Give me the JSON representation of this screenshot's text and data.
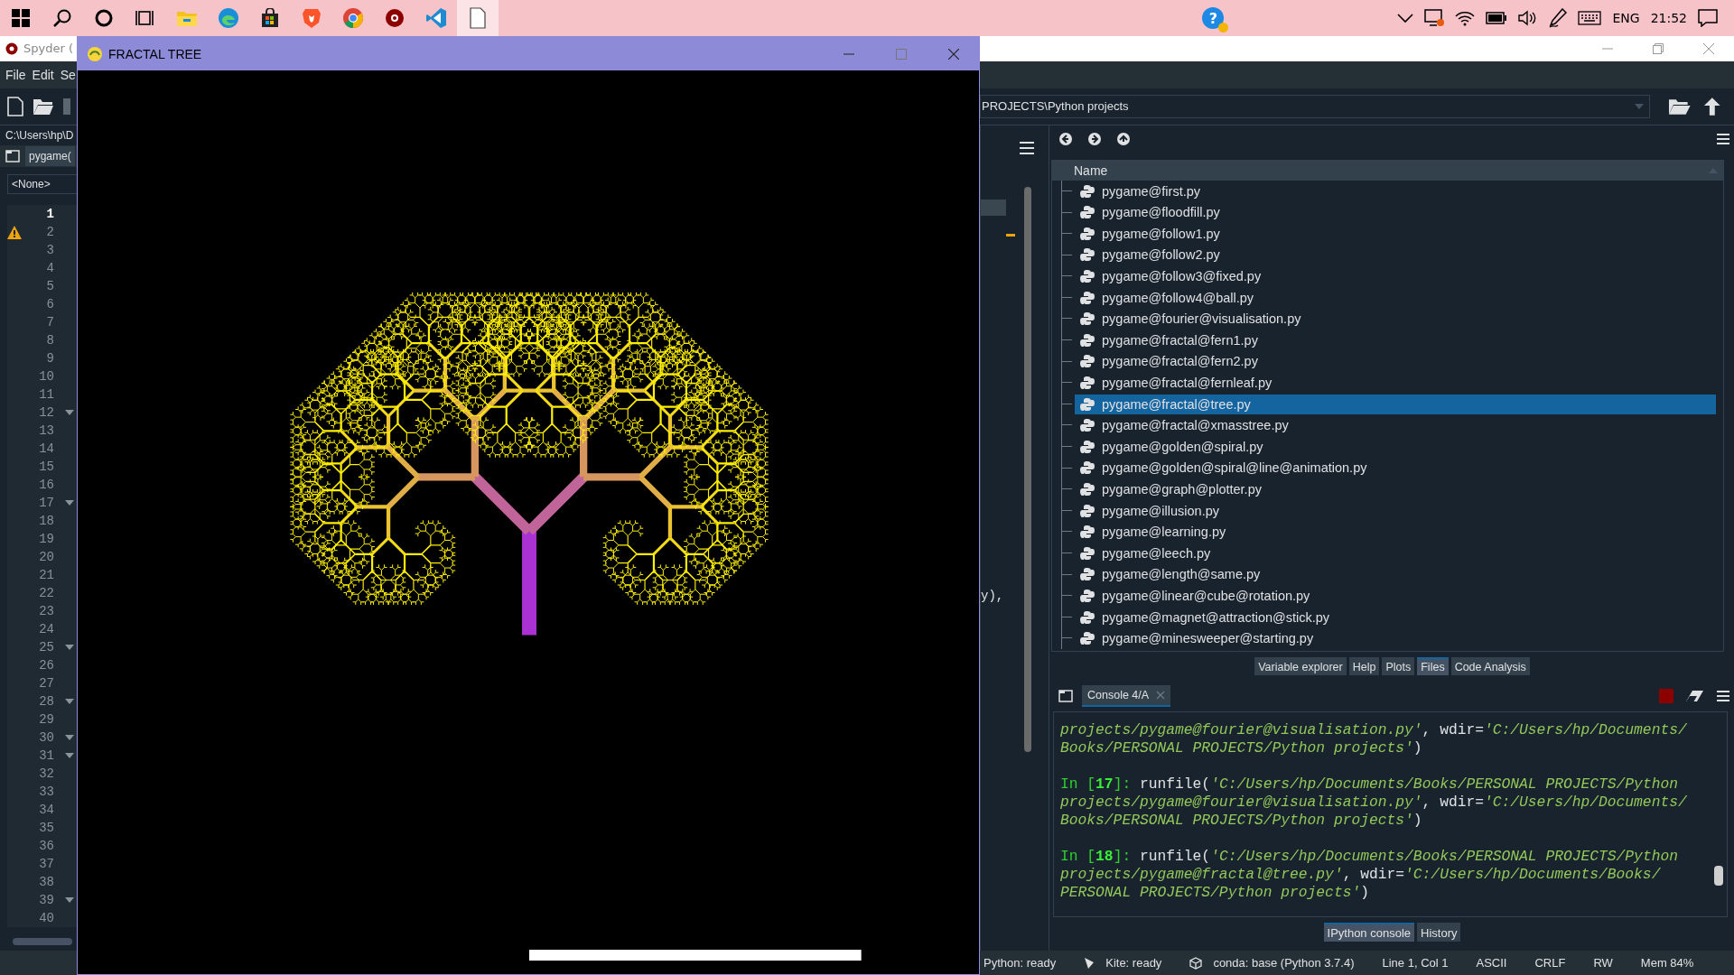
{
  "taskbar": {
    "apps": [
      {
        "kind": "windows",
        "selected": false
      },
      {
        "kind": "search",
        "selected": false
      },
      {
        "kind": "cortana",
        "selected": false
      },
      {
        "kind": "taskview",
        "selected": false
      },
      {
        "kind": "explorer",
        "selected": false
      },
      {
        "kind": "edge",
        "selected": false
      },
      {
        "kind": "store",
        "selected": false
      },
      {
        "kind": "brave",
        "selected": false
      },
      {
        "kind": "chrome",
        "selected": false
      },
      {
        "kind": "spyder",
        "selected": false
      },
      {
        "kind": "vscode",
        "selected": false
      },
      {
        "kind": "notepad",
        "selected": true
      }
    ],
    "help_badge": "?",
    "language": "ENG",
    "time": "21:52"
  },
  "spyder": {
    "title": "Spyder (",
    "menu": [
      "File",
      "Edit",
      "Se"
    ],
    "editor_path": "C:\\Users\\hp\\D",
    "editor_tab": "pygame(",
    "outline_combo": "<None>",
    "lines": [
      {
        "number": "1",
        "current": true,
        "warning": false,
        "fold": false
      },
      {
        "number": "2",
        "current": false,
        "warning": true,
        "fold": false
      },
      {
        "number": "3",
        "current": false,
        "warning": false,
        "fold": false
      },
      {
        "number": "4",
        "current": false,
        "warning": false,
        "fold": false
      },
      {
        "number": "5",
        "current": false,
        "warning": false,
        "fold": false
      },
      {
        "number": "6",
        "current": false,
        "warning": false,
        "fold": false
      },
      {
        "number": "7",
        "current": false,
        "warning": false,
        "fold": false
      },
      {
        "number": "8",
        "current": false,
        "warning": false,
        "fold": false
      },
      {
        "number": "9",
        "current": false,
        "warning": false,
        "fold": false
      },
      {
        "number": "10",
        "current": false,
        "warning": false,
        "fold": false
      },
      {
        "number": "11",
        "current": false,
        "warning": false,
        "fold": false
      },
      {
        "number": "12",
        "current": false,
        "warning": false,
        "fold": true
      },
      {
        "number": "13",
        "current": false,
        "warning": false,
        "fold": false
      },
      {
        "number": "14",
        "current": false,
        "warning": false,
        "fold": false
      },
      {
        "number": "15",
        "current": false,
        "warning": false,
        "fold": false
      },
      {
        "number": "16",
        "current": false,
        "warning": false,
        "fold": false
      },
      {
        "number": "17",
        "current": false,
        "warning": false,
        "fold": true
      },
      {
        "number": "18",
        "current": false,
        "warning": false,
        "fold": false
      },
      {
        "number": "19",
        "current": false,
        "warning": false,
        "fold": false
      },
      {
        "number": "20",
        "current": false,
        "warning": false,
        "fold": false
      },
      {
        "number": "21",
        "current": false,
        "warning": false,
        "fold": false
      },
      {
        "number": "22",
        "current": false,
        "warning": false,
        "fold": false
      },
      {
        "number": "23",
        "current": false,
        "warning": false,
        "fold": false
      },
      {
        "number": "24",
        "current": false,
        "warning": false,
        "fold": false
      },
      {
        "number": "25",
        "current": false,
        "warning": false,
        "fold": true
      },
      {
        "number": "26",
        "current": false,
        "warning": false,
        "fold": false
      },
      {
        "number": "27",
        "current": false,
        "warning": false,
        "fold": false
      },
      {
        "number": "28",
        "current": false,
        "warning": false,
        "fold": true
      },
      {
        "number": "29",
        "current": false,
        "warning": false,
        "fold": false
      },
      {
        "number": "30",
        "current": false,
        "warning": false,
        "fold": true
      },
      {
        "number": "31",
        "current": false,
        "warning": false,
        "fold": true
      },
      {
        "number": "32",
        "current": false,
        "warning": false,
        "fold": false
      },
      {
        "number": "33",
        "current": false,
        "warning": false,
        "fold": false
      },
      {
        "number": "34",
        "current": false,
        "warning": false,
        "fold": false
      },
      {
        "number": "35",
        "current": false,
        "warning": false,
        "fold": false
      },
      {
        "number": "36",
        "current": false,
        "warning": false,
        "fold": false
      },
      {
        "number": "37",
        "current": false,
        "warning": false,
        "fold": false
      },
      {
        "number": "38",
        "current": false,
        "warning": false,
        "fold": false
      },
      {
        "number": "39",
        "current": false,
        "warning": false,
        "fold": true
      },
      {
        "number": "40",
        "current": false,
        "warning": false,
        "fold": false
      }
    ],
    "code_fragment": "y),",
    "files": {
      "path": "PROJECTS\\Python projects",
      "column": "Name",
      "items": [
        {
          "name": "pygame@first.py",
          "selected": false
        },
        {
          "name": "pygame@floodfill.py",
          "selected": false
        },
        {
          "name": "pygame@follow1.py",
          "selected": false
        },
        {
          "name": "pygame@follow2.py",
          "selected": false
        },
        {
          "name": "pygame@follow3@fixed.py",
          "selected": false
        },
        {
          "name": "pygame@follow4@ball.py",
          "selected": false
        },
        {
          "name": "pygame@fourier@visualisation.py",
          "selected": false
        },
        {
          "name": "pygame@fractal@fern1.py",
          "selected": false
        },
        {
          "name": "pygame@fractal@fern2.py",
          "selected": false
        },
        {
          "name": "pygame@fractal@fernleaf.py",
          "selected": false
        },
        {
          "name": "pygame@fractal@tree.py",
          "selected": true
        },
        {
          "name": "pygame@fractal@xmasstree.py",
          "selected": false
        },
        {
          "name": "pygame@golden@spiral.py",
          "selected": false
        },
        {
          "name": "pygame@golden@spiral@line@animation.py",
          "selected": false
        },
        {
          "name": "pygame@graph@plotter.py",
          "selected": false
        },
        {
          "name": "pygame@illusion.py",
          "selected": false
        },
        {
          "name": "pygame@learning.py",
          "selected": false
        },
        {
          "name": "pygame@leech.py",
          "selected": false
        },
        {
          "name": "pygame@length@same.py",
          "selected": false
        },
        {
          "name": "pygame@linear@cube@rotation.py",
          "selected": false
        },
        {
          "name": "pygame@magnet@attraction@stick.py",
          "selected": false
        },
        {
          "name": "pygame@minesweeper@starting.py",
          "selected": false
        }
      ]
    },
    "pane_tabs": [
      {
        "label": "Variable explorer",
        "selected": false
      },
      {
        "label": "Help",
        "selected": false
      },
      {
        "label": "Plots",
        "selected": false
      },
      {
        "label": "Files",
        "selected": true
      },
      {
        "label": "Code Analysis",
        "selected": false
      }
    ],
    "console": {
      "tab": "Console 4/A",
      "blocks": [
        {
          "lines": [
            [
              {
                "kind": "string",
                "text": "projects/pygame@fourier@visualisation.py'"
              },
              {
                "kind": "plain",
                "text": ", wdir="
              },
              {
                "kind": "string",
                "text": "'C:/Users/hp/Documents/"
              }
            ],
            [
              {
                "kind": "string",
                "text": "Books/PERSONAL PROJECTS/Python projects'"
              },
              {
                "kind": "plain",
                "text": ")"
              }
            ]
          ]
        },
        {
          "prompt": {
            "before": "In [",
            "number": "17",
            "after": "]:"
          },
          "lines": [
            [
              {
                "kind": "plain",
                "text": "runfile("
              },
              {
                "kind": "string",
                "text": "'C:/Users/hp/Documents/Books/PERSONAL PROJECTS/Python"
              }
            ],
            [
              {
                "kind": "string",
                "text": "projects/pygame@fourier@visualisation.py'"
              },
              {
                "kind": "plain",
                "text": ", wdir="
              },
              {
                "kind": "string",
                "text": "'C:/Users/hp/Documents/"
              }
            ],
            [
              {
                "kind": "string",
                "text": "Books/PERSONAL PROJECTS/Python projects'"
              },
              {
                "kind": "plain",
                "text": ")"
              }
            ]
          ]
        },
        {
          "prompt": {
            "before": "In [",
            "number": "18",
            "after": "]:"
          },
          "lines": [
            [
              {
                "kind": "plain",
                "text": "runfile("
              },
              {
                "kind": "string",
                "text": "'C:/Users/hp/Documents/Books/PERSONAL PROJECTS/Python"
              }
            ],
            [
              {
                "kind": "string",
                "text": "projects/pygame@fractal@tree.py'"
              },
              {
                "kind": "plain",
                "text": ", wdir="
              },
              {
                "kind": "string",
                "text": "'C:/Users/hp/Documents/Books/"
              }
            ],
            [
              {
                "kind": "string",
                "text": "PERSONAL PROJECTS/Python projects'"
              },
              {
                "kind": "plain",
                "text": ")"
              }
            ]
          ]
        }
      ]
    },
    "console_tabs": [
      {
        "label": "IPython console",
        "selected": true
      },
      {
        "label": "History",
        "selected": false
      }
    ],
    "status": [
      {
        "kind": "plain",
        "text": "Python: ready"
      },
      {
        "kind": "kite",
        "text": "Kite: ready"
      },
      {
        "kind": "cube",
        "text": "conda: base (Python 3.7.4)"
      },
      {
        "kind": "plain",
        "text": "Line 1, Col 1"
      },
      {
        "kind": "plain",
        "text": "ASCII"
      },
      {
        "kind": "plain",
        "text": "CRLF"
      },
      {
        "kind": "plain",
        "text": "RW"
      },
      {
        "kind": "plain",
        "text": "Mem 84%"
      }
    ]
  },
  "game_window": {
    "title": "FRACTAL TREE"
  }
}
